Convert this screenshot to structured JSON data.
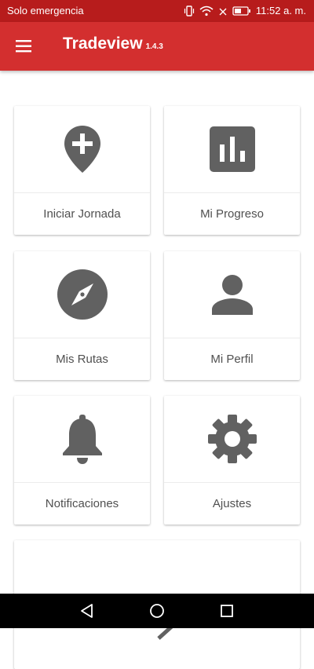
{
  "status_bar": {
    "carrier": "Solo emergencia",
    "time": "11:52 a. m."
  },
  "app_bar": {
    "title": "Tradeview",
    "version": "1.4.3",
    "menu_icon": "hamburger-menu-icon"
  },
  "cards": [
    {
      "label": "Iniciar Jornada",
      "icon": "add-location-icon"
    },
    {
      "label": "Mi Progreso",
      "icon": "bar-chart-icon"
    },
    {
      "label": "Mis Rutas",
      "icon": "compass-icon"
    },
    {
      "label": "Mi Perfil",
      "icon": "person-icon"
    },
    {
      "label": "Notificaciones",
      "icon": "bell-icon"
    },
    {
      "label": "Ajustes",
      "icon": "gear-icon"
    },
    {
      "label": "",
      "icon": "arrow-right-icon"
    }
  ],
  "colors": {
    "primary": "#d32f2f",
    "status_bar": "#b71c1c",
    "icon": "#616161",
    "label": "#505050"
  },
  "nav_bar": {
    "back_icon": "triangle-back-icon",
    "home_icon": "circle-home-icon",
    "recents_icon": "square-recents-icon"
  }
}
